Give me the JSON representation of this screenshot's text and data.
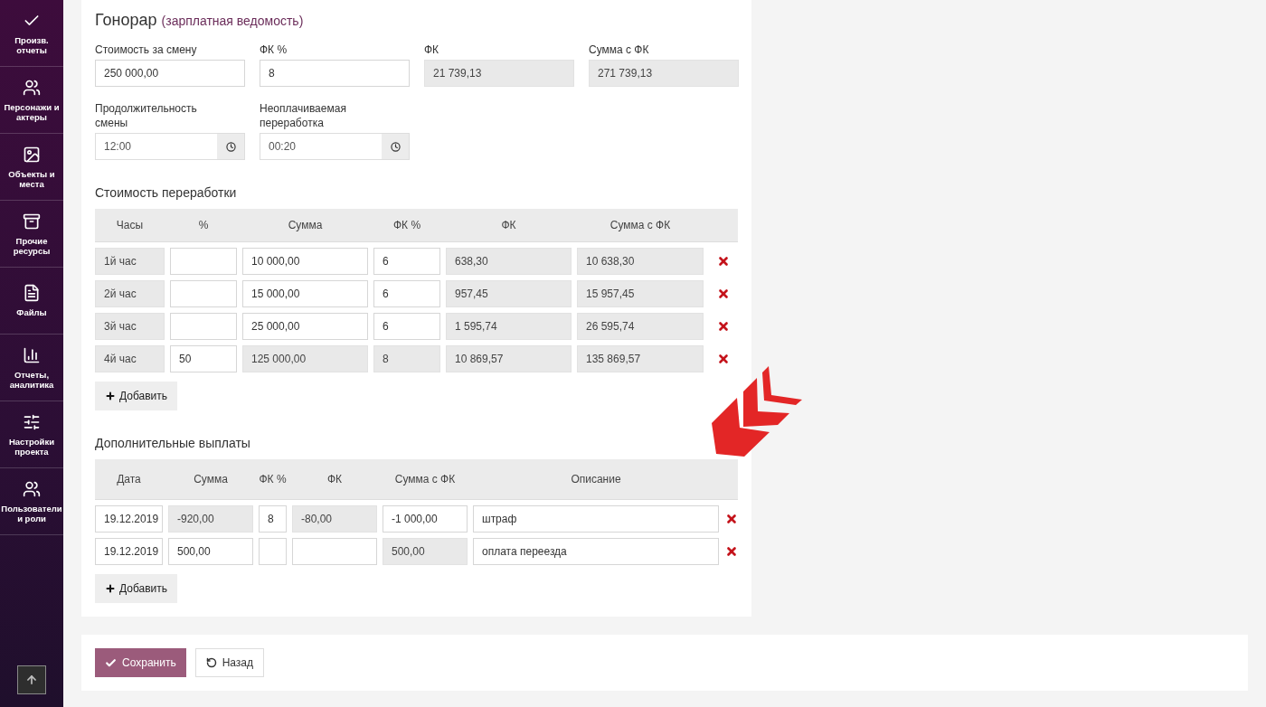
{
  "sidebar": {
    "items": [
      {
        "label": "Произв. отчеты"
      },
      {
        "label": "Персонажи и актеры"
      },
      {
        "label": "Объекты и места"
      },
      {
        "label": "Прочие ресурсы"
      },
      {
        "label": "Файлы"
      },
      {
        "label": "Отчеты, аналитика"
      },
      {
        "label": "Настройки проекта"
      },
      {
        "label": "Пользователи и роли"
      }
    ]
  },
  "fee": {
    "title": "Гонорар",
    "subtitle": "(зарплатная ведомость)",
    "fields": [
      {
        "label": "Стоимость за смену",
        "value": "250 000,00",
        "readonly": false,
        "kind": "text"
      },
      {
        "label": "ФК %",
        "value": "8",
        "readonly": false,
        "kind": "text"
      },
      {
        "label": "ФК",
        "value": "21 739,13",
        "readonly": true,
        "kind": "text"
      },
      {
        "label": "Сумма с ФК",
        "value": "271 739,13",
        "readonly": true,
        "kind": "text"
      },
      {
        "label": "Продолжительность смены",
        "value": "12:00",
        "readonly": false,
        "kind": "time"
      },
      {
        "label": "Неоплачиваемая переработка",
        "value": "00:20",
        "readonly": false,
        "kind": "time"
      }
    ]
  },
  "overtime": {
    "title": "Стоимость переработки",
    "columns": [
      "Часы",
      "%",
      "Сумма",
      "ФК %",
      "ФК",
      "Сумма с ФК"
    ],
    "rows": [
      {
        "cells": [
          {
            "value": "1й час",
            "readonly": true
          },
          {
            "readonly": false
          },
          {
            "value": "10 000,00",
            "readonly": false
          },
          {
            "value": "6",
            "readonly": false
          },
          {
            "value": "638,30",
            "readonly": true
          },
          {
            "value": "10 638,30",
            "readonly": true
          }
        ]
      },
      {
        "cells": [
          {
            "value": "2й час",
            "readonly": true
          },
          {
            "readonly": false
          },
          {
            "value": "15 000,00",
            "readonly": false
          },
          {
            "value": "6",
            "readonly": false
          },
          {
            "value": "957,45",
            "readonly": true
          },
          {
            "value": "15 957,45",
            "readonly": true
          }
        ]
      },
      {
        "cells": [
          {
            "value": "3й час",
            "readonly": true
          },
          {
            "readonly": false
          },
          {
            "value": "25 000,00",
            "readonly": false
          },
          {
            "value": "6",
            "readonly": false
          },
          {
            "value": "1 595,74",
            "readonly": true
          },
          {
            "value": "26 595,74",
            "readonly": true
          }
        ]
      },
      {
        "cells": [
          {
            "value": "4й час",
            "readonly": true
          },
          {
            "value": "50",
            "readonly": false
          },
          {
            "value": "125 000,00",
            "readonly": true
          },
          {
            "value": "8",
            "readonly": true
          },
          {
            "value": "10 869,57",
            "readonly": true
          },
          {
            "value": "135 869,57",
            "readonly": true
          }
        ]
      }
    ],
    "add_button": "Добавить"
  },
  "extra": {
    "title": "Дополнительные выплаты",
    "columns": [
      "Дата",
      "Сумма",
      "ФК %",
      "ФК",
      "Сумма с ФК",
      "Описание"
    ],
    "rows": [
      {
        "cells": [
          {
            "value": "19.12.2019",
            "readonly": false
          },
          {
            "value": "-920,00",
            "readonly": true
          },
          {
            "value": "8",
            "readonly": false
          },
          {
            "value": "-80,00",
            "readonly": true
          },
          {
            "value": "-1 000,00",
            "readonly": false
          },
          {
            "value": "штраф",
            "readonly": false
          }
        ]
      },
      {
        "cells": [
          {
            "value": "19.12.2019",
            "readonly": false
          },
          {
            "value": "500,00",
            "readonly": false
          },
          {
            "readonly": false
          },
          {
            "readonly": false
          },
          {
            "value": "500,00",
            "readonly": true
          },
          {
            "value": "оплата переезда",
            "readonly": false
          }
        ]
      }
    ],
    "add_button": "Добавить"
  },
  "footer": {
    "save_button": "Сохранить",
    "back_button": "Назад"
  }
}
